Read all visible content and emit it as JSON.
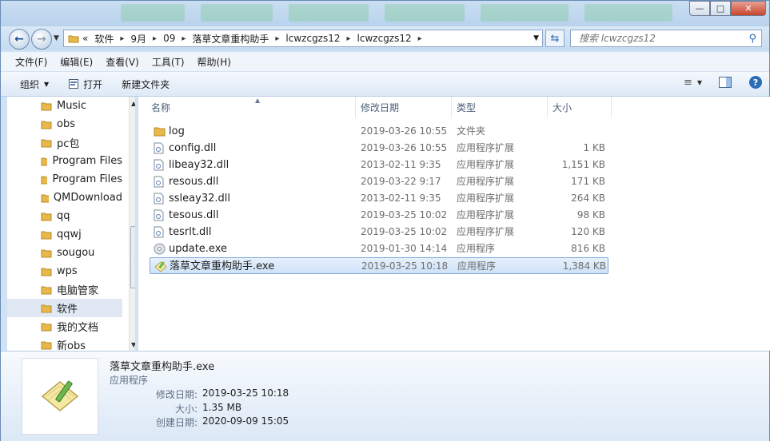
{
  "address": {
    "overflow": "«",
    "crumbs": [
      "软件",
      "9月",
      "09",
      "落草文章重构助手",
      "lcwzcgzs12",
      "lcwzcgzs12"
    ]
  },
  "search": {
    "placeholder": "搜索 lcwzcgzs12"
  },
  "menus": [
    "文件(F)",
    "编辑(E)",
    "查看(V)",
    "工具(T)",
    "帮助(H)"
  ],
  "toolbar": {
    "organize": "组织",
    "open": "打开",
    "new_folder": "新建文件夹"
  },
  "nav": {
    "items": [
      "Music",
      "obs",
      "pc包",
      "Program Files",
      "Program Files",
      "QMDownload",
      "qq",
      "qqwj",
      "sougou",
      "wps",
      "电脑管家",
      "软件",
      "我的文档",
      "新obs"
    ],
    "selected": "软件"
  },
  "columns": {
    "name": "名称",
    "date": "修改日期",
    "type": "类型",
    "size": "大小"
  },
  "files": [
    {
      "name": "log",
      "date": "2019-03-26 10:55",
      "type": "文件夹",
      "size": "",
      "icon": "folder-icon"
    },
    {
      "name": "config.dll",
      "date": "2019-03-26 10:55",
      "type": "应用程序扩展",
      "size": "1 KB",
      "icon": "dll-icon"
    },
    {
      "name": "libeay32.dll",
      "date": "2013-02-11 9:35",
      "type": "应用程序扩展",
      "size": "1,151 KB",
      "icon": "dll-icon"
    },
    {
      "name": "resous.dll",
      "date": "2019-03-22 9:17",
      "type": "应用程序扩展",
      "size": "171 KB",
      "icon": "dll-icon"
    },
    {
      "name": "ssleay32.dll",
      "date": "2013-02-11 9:35",
      "type": "应用程序扩展",
      "size": "264 KB",
      "icon": "dll-icon"
    },
    {
      "name": "tesous.dll",
      "date": "2019-03-25 10:02",
      "type": "应用程序扩展",
      "size": "98 KB",
      "icon": "dll-icon"
    },
    {
      "name": "tesrlt.dll",
      "date": "2019-03-25 10:02",
      "type": "应用程序扩展",
      "size": "120 KB",
      "icon": "dll-icon"
    },
    {
      "name": "update.exe",
      "date": "2019-01-30 14:14",
      "type": "应用程序",
      "size": "816 KB",
      "icon": "exe-icon"
    },
    {
      "name": "落草文章重构助手.exe",
      "date": "2019-03-25 10:18",
      "type": "应用程序",
      "size": "1,384 KB",
      "icon": "notepad-pencil-icon"
    }
  ],
  "selected_file": "落草文章重构助手.exe",
  "details": {
    "title": "落草文章重构助手.exe",
    "type": "应用程序",
    "modified_label": "修改日期:",
    "modified_value": "2019-03-25 10:18",
    "size_label": "大小:",
    "size_value": "1.35 MB",
    "created_label": "创建日期:",
    "created_value": "2020-09-09 15:05"
  },
  "colors": {
    "accent": "#2a6db5",
    "selection": "#cfe2f8",
    "folder": "#e8b94a"
  }
}
